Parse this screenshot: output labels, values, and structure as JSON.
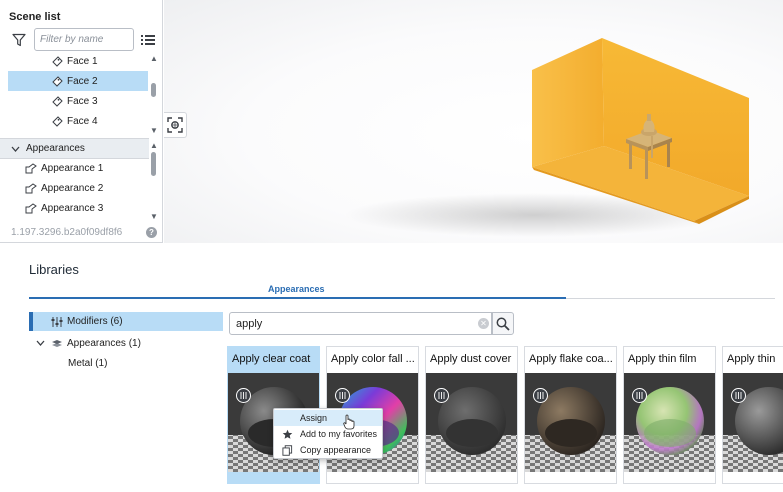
{
  "scene_list": {
    "title": "Scene list",
    "filter_placeholder": "Filter by name",
    "faces": [
      "Face 1",
      "Face 2",
      "Face 3",
      "Face 4"
    ],
    "selected_face": "Face 2",
    "appearances_header": "Appearances",
    "appearances": [
      "Appearance 1",
      "Appearance 2",
      "Appearance 3"
    ],
    "version": "1.197.3296.b2a0f09df8f6",
    "help": "?"
  },
  "viewport": {
    "model_color": "#f5b132",
    "table_color": "#c9a56a"
  },
  "libraries": {
    "title": "Libraries",
    "tab": "Appearances",
    "tree": {
      "modifiers": "Modifiers (6)",
      "appearances": "Appearances (1)",
      "metal": "Metal (1)"
    },
    "search_value": "apply",
    "cards": [
      {
        "title": "Apply clear coat",
        "selected": true
      },
      {
        "title": "Apply color fall ..."
      },
      {
        "title": "Apply dust cover"
      },
      {
        "title": "Apply flake coa..."
      },
      {
        "title": "Apply thin film"
      },
      {
        "title": "Apply thin"
      }
    ]
  },
  "context_menu": {
    "items": [
      "Assign",
      "Add to my favorites",
      "Copy appearance"
    ],
    "hovered": "Assign"
  },
  "colors": {
    "accent": "#2a6db3",
    "selection": "#b8dcf6"
  }
}
